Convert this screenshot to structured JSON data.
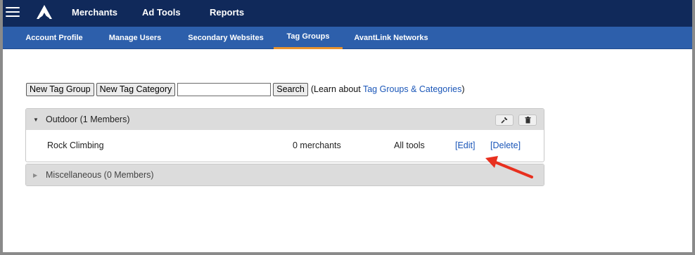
{
  "topnav": {
    "menu_icon": "hamburger-menu-icon",
    "logo_icon": "avantlink-logo-icon",
    "items": [
      {
        "label": "Merchants"
      },
      {
        "label": "Ad Tools"
      },
      {
        "label": "Reports"
      }
    ]
  },
  "subnav": {
    "items": [
      {
        "label": "Account Profile"
      },
      {
        "label": "Manage Users"
      },
      {
        "label": "Secondary Websites"
      },
      {
        "label": "Tag Groups"
      },
      {
        "label": "AvantLink Networks"
      }
    ],
    "active": "Tag Groups",
    "active_color": "#e8922d"
  },
  "toolbar": {
    "new_group_label": "New Tag Group",
    "new_category_label": "New Tag Category",
    "search_value": "",
    "search_button_label": "Search",
    "learn_prefix": "(Learn about ",
    "learn_link": "Tag Groups & Categories",
    "learn_suffix": ")"
  },
  "groups": [
    {
      "title": "Outdoor (1 Members)",
      "expanded": true,
      "actions": [
        {
          "icon": "wrench-icon"
        },
        {
          "icon": "trash-icon"
        }
      ],
      "members": [
        {
          "name": "Rock Climbing",
          "merchants": "0 merchants",
          "tools": "All tools",
          "edit": "[Edit]",
          "delete": "[Delete]"
        }
      ]
    },
    {
      "title": "Miscellaneous (0 Members)",
      "expanded": false
    }
  ],
  "annotation": {
    "icon": "red-arrow-icon",
    "color": "#e8301f"
  },
  "colors": {
    "topbar": "#10295a",
    "subnav": "#2d5fab",
    "link": "#1a56b8"
  }
}
